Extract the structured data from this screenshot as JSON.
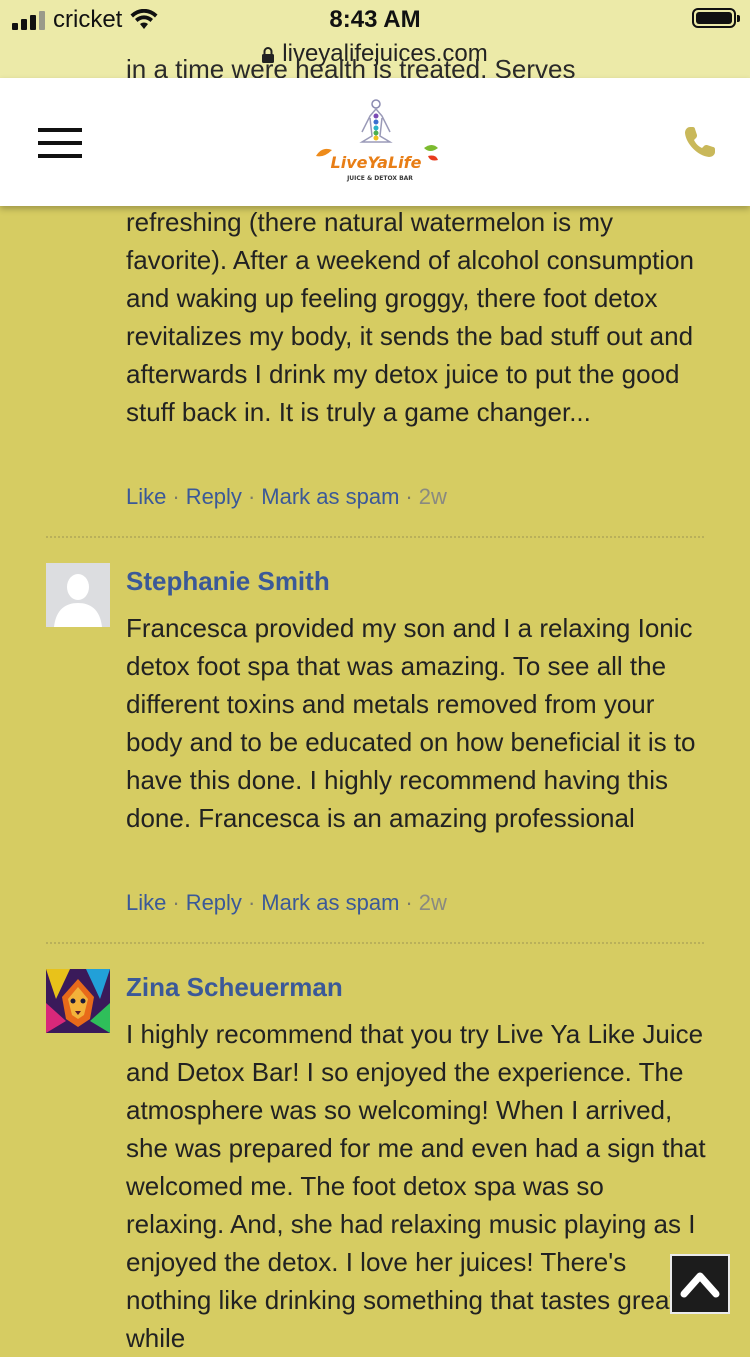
{
  "status_bar": {
    "carrier": "cricket",
    "time": "8:43 AM",
    "url": "liveyalifejuices.com"
  },
  "header": {
    "logo_text": "LiveYaLife",
    "logo_tagline": "JUICE & DETOX BAR"
  },
  "peek_text": "in a time were health is treated. Serves",
  "comments": [
    {
      "text": "refreshing (there natural watermelon is my favorite). After a weekend of alcohol consumption and waking up feeling groggy, there foot detox revitalizes my body, it sends the bad stuff out and afterwards I drink my detox juice to put the good stuff back in. It is truly a game changer...",
      "actions": {
        "like": "Like",
        "reply": "Reply",
        "spam": "Mark as spam",
        "time": "2w"
      }
    },
    {
      "author": "Stephanie Smith",
      "text": "Francesca provided my son and I a relaxing Ionic detox foot spa that was amazing. To see all the different toxins and metals removed from your body and to be educated on how beneficial it is to have this done. I highly recommend having this done. Francesca is an amazing professional",
      "actions": {
        "like": "Like",
        "reply": "Reply",
        "spam": "Mark as spam",
        "time": "2w"
      }
    },
    {
      "author": "Zina Scheuerman",
      "text": "I highly recommend that you try Live Ya Like Juice and Detox Bar! I so enjoyed the experience. The atmosphere was so welcoming! When I arrived, she was prepared for me and even had a sign that welcomed me. The foot detox spa was so relaxing. And, she had relaxing music playing as I enjoyed the detox. I love her juices! There's nothing like drinking something that tastes great while"
    }
  ],
  "colors": {
    "page_bg": "#d6cc62",
    "link": "#3b5998",
    "accent": "#c9b85a"
  }
}
